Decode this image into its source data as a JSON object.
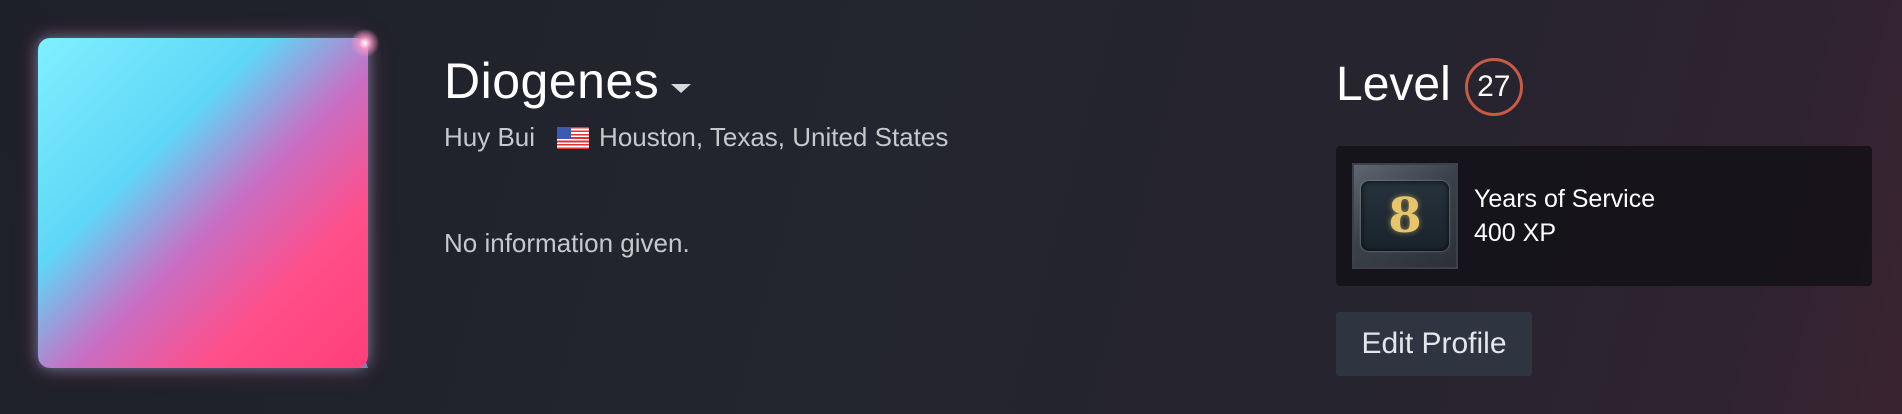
{
  "profile": {
    "persona_name": "Diogenes",
    "real_name": "Huy Bui",
    "location": "Houston, Texas, United States",
    "flag_icon": "us-flag-icon",
    "summary": "No information given."
  },
  "level": {
    "label": "Level",
    "value": "27",
    "ring_color": "#c95a44"
  },
  "badge": {
    "digit": "8",
    "title": "Years of Service",
    "xp": "400 XP"
  },
  "actions": {
    "edit_profile_label": "Edit Profile"
  },
  "colors": {
    "frame_cyan": "#7ff0ff",
    "frame_pink": "#ff3e7a",
    "badge_gold": "#e8c56a"
  }
}
